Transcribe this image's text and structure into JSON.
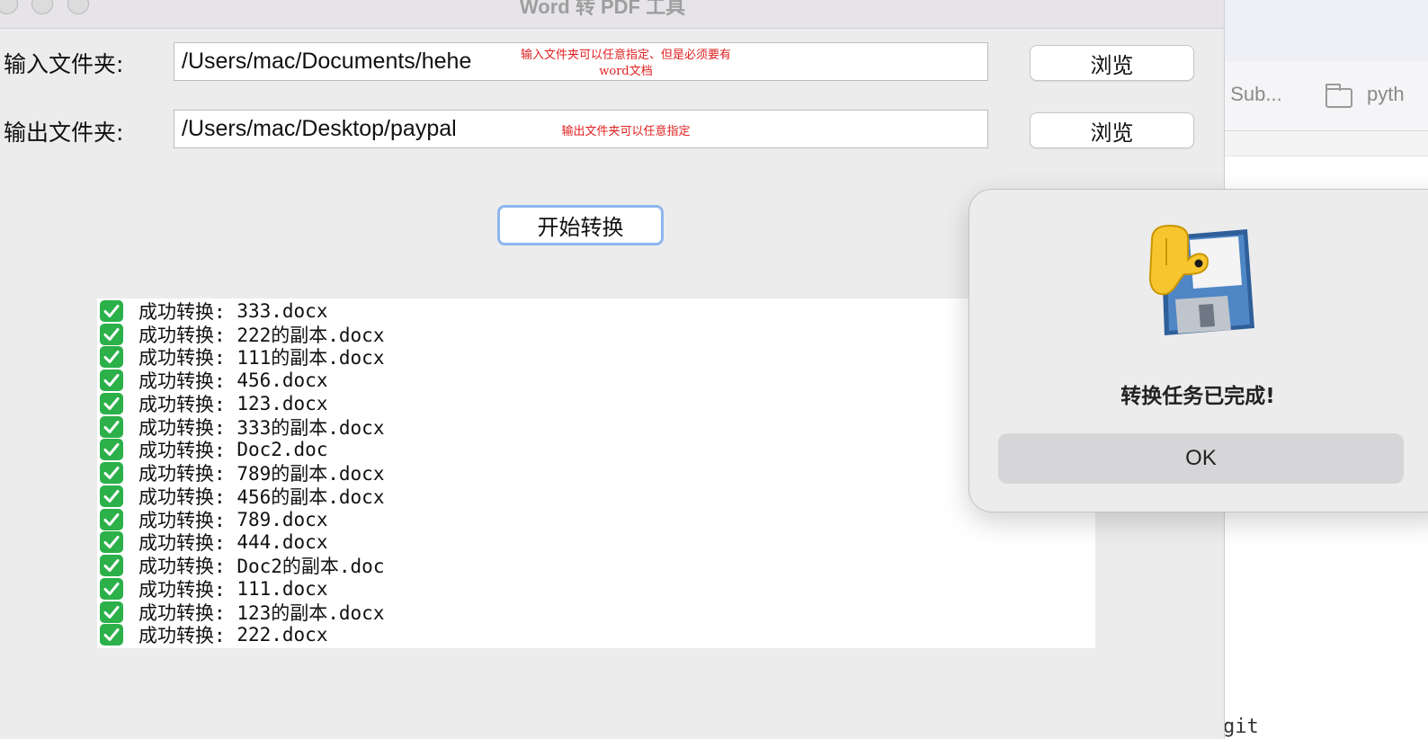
{
  "window": {
    "title": "Word 转 PDF 工具"
  },
  "input_row": {
    "label": "输入文件夹:",
    "value": "/Users/mac/Documents/hehe",
    "note_line1": "输入文件夹可以任意指定、但是必须要有",
    "note_line2": "word文档",
    "browse_label": "浏览"
  },
  "output_row": {
    "label": "输出文件夹:",
    "value": "/Users/mac/Desktop/paypal",
    "note": "输出文件夹可以任意指定",
    "browse_label": "浏览"
  },
  "start_button": "开始转换",
  "log": {
    "prefix": "成功转换:",
    "check_icon": "white-heavy-check-mark-icon",
    "files": [
      "333.docx",
      "222的副本.docx",
      "111的副本.docx",
      "456.docx",
      "123.docx",
      "333的副本.docx",
      "Doc2.doc",
      "789的副本.docx",
      "456的副本.docx",
      "789.docx",
      "444.docx",
      "Doc2的副本.doc",
      "111.docx",
      "123的副本.docx",
      "222.docx"
    ]
  },
  "dialog": {
    "icon": "python-launcher-icon",
    "message": "转换任务已完成!",
    "ok_label": "OK"
  },
  "background_window": {
    "tab1": "] Sub...",
    "tab2": "pyth",
    "bottom_text": "git"
  },
  "colors": {
    "note_red": "#e02020",
    "check_green": "#2cb04a",
    "focus_ring": "#8fb6ee"
  }
}
